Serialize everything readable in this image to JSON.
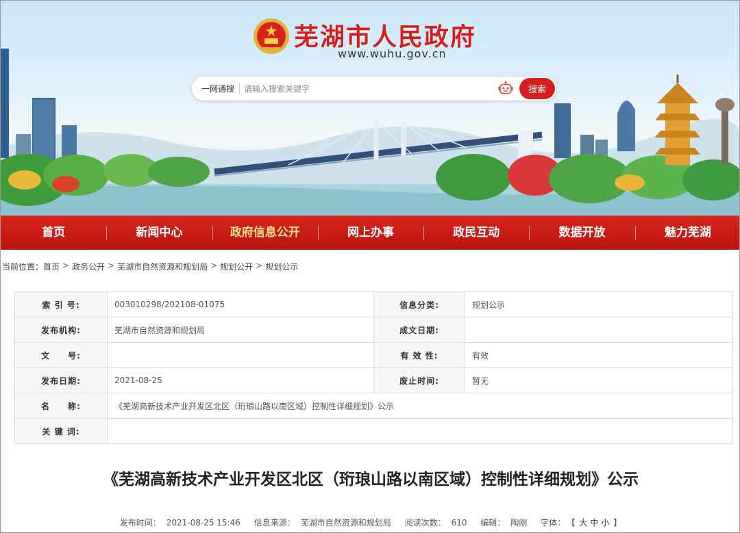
{
  "header": {
    "site_title": "芜湖市人民政府",
    "site_url": "www.wuhu.gov.cn",
    "emblem_icon": "national-emblem-icon",
    "brand_red": "#d61d1d"
  },
  "search": {
    "scope_label": "一网通搜",
    "placeholder": "请输入搜索关键字",
    "button_label": "搜索",
    "assistant_icon": "robot-icon"
  },
  "nav": {
    "items": [
      {
        "label": "首页",
        "active": false
      },
      {
        "label": "新闻中心",
        "active": false
      },
      {
        "label": "政府信息公开",
        "active": true
      },
      {
        "label": "网上办事",
        "active": false
      },
      {
        "label": "政民互动",
        "active": false
      },
      {
        "label": "数据开放",
        "active": false
      },
      {
        "label": "魅力芜湖",
        "active": false
      }
    ],
    "bar_color": "#c41a14",
    "active_color": "#ffe48a"
  },
  "breadcrumb": {
    "prefix": "当前位置：",
    "items": [
      "首页",
      "政务公开",
      "芜湖市自然资源和规划局",
      "规划公开",
      "规划公示"
    ],
    "separator": ">"
  },
  "info": {
    "index_no_label": "索 引 号:",
    "index_no": "003010298/202108-01075",
    "category_label": "信息分类:",
    "category": "规划公示",
    "publisher_label": "发布机构:",
    "publisher": "芜湖市自然资源和规划局",
    "created_label": "成文日期:",
    "created": "",
    "doc_no_label": "文　　号:",
    "doc_no": "",
    "validity_label": "有 效 性:",
    "validity": "有效",
    "publish_date_label": "发布日期:",
    "publish_date": "2021-08-25",
    "expire_label": "废止时间:",
    "expire": "暂无",
    "name_label": "名　　称:",
    "name": "《芜湖高新技术产业开发区北区（珩琅山路以南区域）控制性详细规划》公示",
    "keywords_label": "关 键 词:",
    "keywords": ""
  },
  "article": {
    "title": "《芜湖高新技术产业开发区北区（珩琅山路以南区域）控制性详细规划》公示",
    "meta": {
      "time_label": "发布时间：",
      "time": "2021-08-25 15:46",
      "source_label": "信息来源：",
      "source": "芜湖市自然资源和规划局",
      "views_label": "阅读次数：",
      "views": "610",
      "editor_label": "编辑：",
      "editor": "陶刚",
      "font_label": "字体：",
      "font_open": "【",
      "font_large": "大",
      "font_medium": "中",
      "font_small": "小",
      "font_close": "】"
    }
  }
}
